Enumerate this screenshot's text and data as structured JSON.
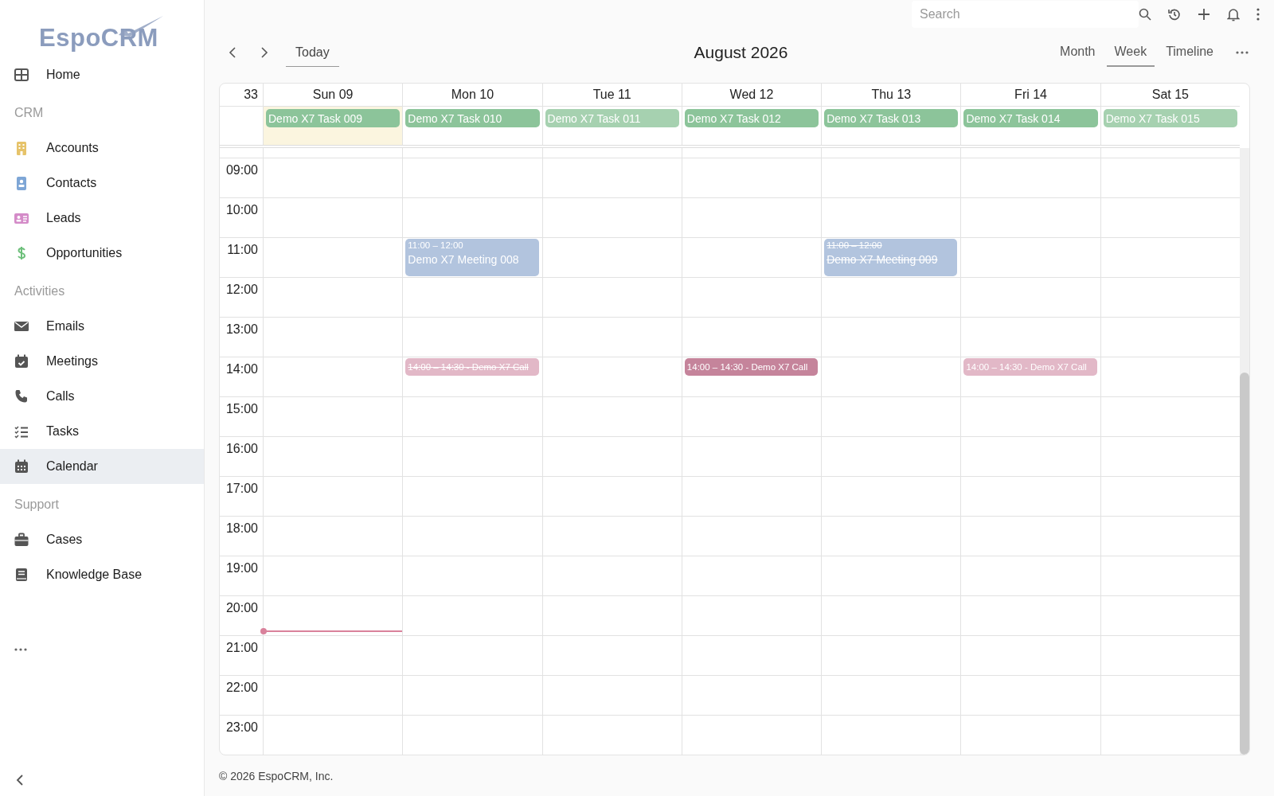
{
  "logo": {
    "text": "EspoCRM"
  },
  "sidebar": {
    "items": [
      {
        "kind": "link",
        "label": "Home",
        "selected": false
      },
      {
        "kind": "header",
        "label": "CRM"
      },
      {
        "kind": "link",
        "label": "Accounts",
        "selected": false
      },
      {
        "kind": "link",
        "label": "Contacts",
        "selected": false
      },
      {
        "kind": "link",
        "label": "Leads",
        "selected": false
      },
      {
        "kind": "link",
        "label": "Opportunities",
        "selected": false
      },
      {
        "kind": "header",
        "label": "Activities"
      },
      {
        "kind": "link",
        "label": "Emails",
        "selected": false
      },
      {
        "kind": "link",
        "label": "Meetings",
        "selected": false
      },
      {
        "kind": "link",
        "label": "Calls",
        "selected": false
      },
      {
        "kind": "link",
        "label": "Tasks",
        "selected": false
      },
      {
        "kind": "link",
        "label": "Calendar",
        "selected": true
      },
      {
        "kind": "header",
        "label": "Support"
      },
      {
        "kind": "link",
        "label": "Cases",
        "selected": false
      },
      {
        "kind": "link",
        "label": "Knowledge Base",
        "selected": false
      }
    ]
  },
  "search": {
    "placeholder": "Search"
  },
  "toolbar": {
    "today": "Today",
    "title": "August 2026",
    "views": [
      {
        "label": "Month",
        "selected": false
      },
      {
        "label": "Week",
        "selected": true
      },
      {
        "label": "Timeline",
        "selected": false
      }
    ]
  },
  "calendar": {
    "week": "33",
    "days": [
      {
        "label": "Sun 09",
        "today": true,
        "task": {
          "title": "Demo X7 Task 009",
          "faded": false
        }
      },
      {
        "label": "Mon 10",
        "today": false,
        "task": {
          "title": "Demo X7 Task 010",
          "faded": false
        }
      },
      {
        "label": "Tue 11",
        "today": false,
        "task": {
          "title": "Demo X7 Task 011",
          "faded": true
        }
      },
      {
        "label": "Wed 12",
        "today": false,
        "task": {
          "title": "Demo X7 Task 012",
          "faded": false
        }
      },
      {
        "label": "Thu 13",
        "today": false,
        "task": {
          "title": "Demo X7 Task 013",
          "faded": false
        }
      },
      {
        "label": "Fri 14",
        "today": false,
        "task": {
          "title": "Demo X7 Task 014",
          "faded": false
        }
      },
      {
        "label": "Sat 15",
        "today": false,
        "task": {
          "title": "Demo X7 Task 015",
          "faded": true
        }
      }
    ],
    "rows": [
      {
        "time": "09:00"
      },
      {
        "time": "10:00"
      },
      {
        "time": "11:00",
        "cells": [
          {},
          {
            "events": [
              {
                "kind": "meeting",
                "time": "11:00 – 12:00",
                "title": "Demo X7 Meeting 008",
                "struck": false,
                "faded": false
              }
            ]
          },
          {},
          {},
          {
            "events": [
              {
                "kind": "meeting",
                "time": "11:00 – 12:00",
                "title": "Demo X7 Meeting 009",
                "struck": true,
                "faded": false
              }
            ]
          },
          {},
          {}
        ]
      },
      {
        "time": "12:00"
      },
      {
        "time": "13:00"
      },
      {
        "time": "14:00",
        "cells": [
          {},
          {
            "events": [
              {
                "kind": "call",
                "title": "14:00 – 14:30 - Demo X7 Call",
                "struck": true,
                "faded": true
              }
            ]
          },
          {},
          {
            "events": [
              {
                "kind": "call",
                "title": "14:00 – 14:30 - Demo X7 Call",
                "struck": false,
                "faded": false
              }
            ]
          },
          {},
          {
            "events": [
              {
                "kind": "call",
                "title": "14:00 – 14:30 - Demo X7 Call",
                "struck": false,
                "faded": true
              }
            ]
          },
          {}
        ]
      },
      {
        "time": "15:00"
      },
      {
        "time": "16:00"
      },
      {
        "time": "17:00"
      },
      {
        "time": "18:00"
      },
      {
        "time": "19:00"
      },
      {
        "time": "20:00",
        "cells": [
          {
            "now_line": true
          },
          {},
          {},
          {},
          {},
          {},
          {}
        ]
      },
      {
        "time": "21:00"
      },
      {
        "time": "22:00"
      },
      {
        "time": "23:00"
      }
    ]
  },
  "footer": {
    "text": "© 2026 EspoCRM, Inc."
  }
}
